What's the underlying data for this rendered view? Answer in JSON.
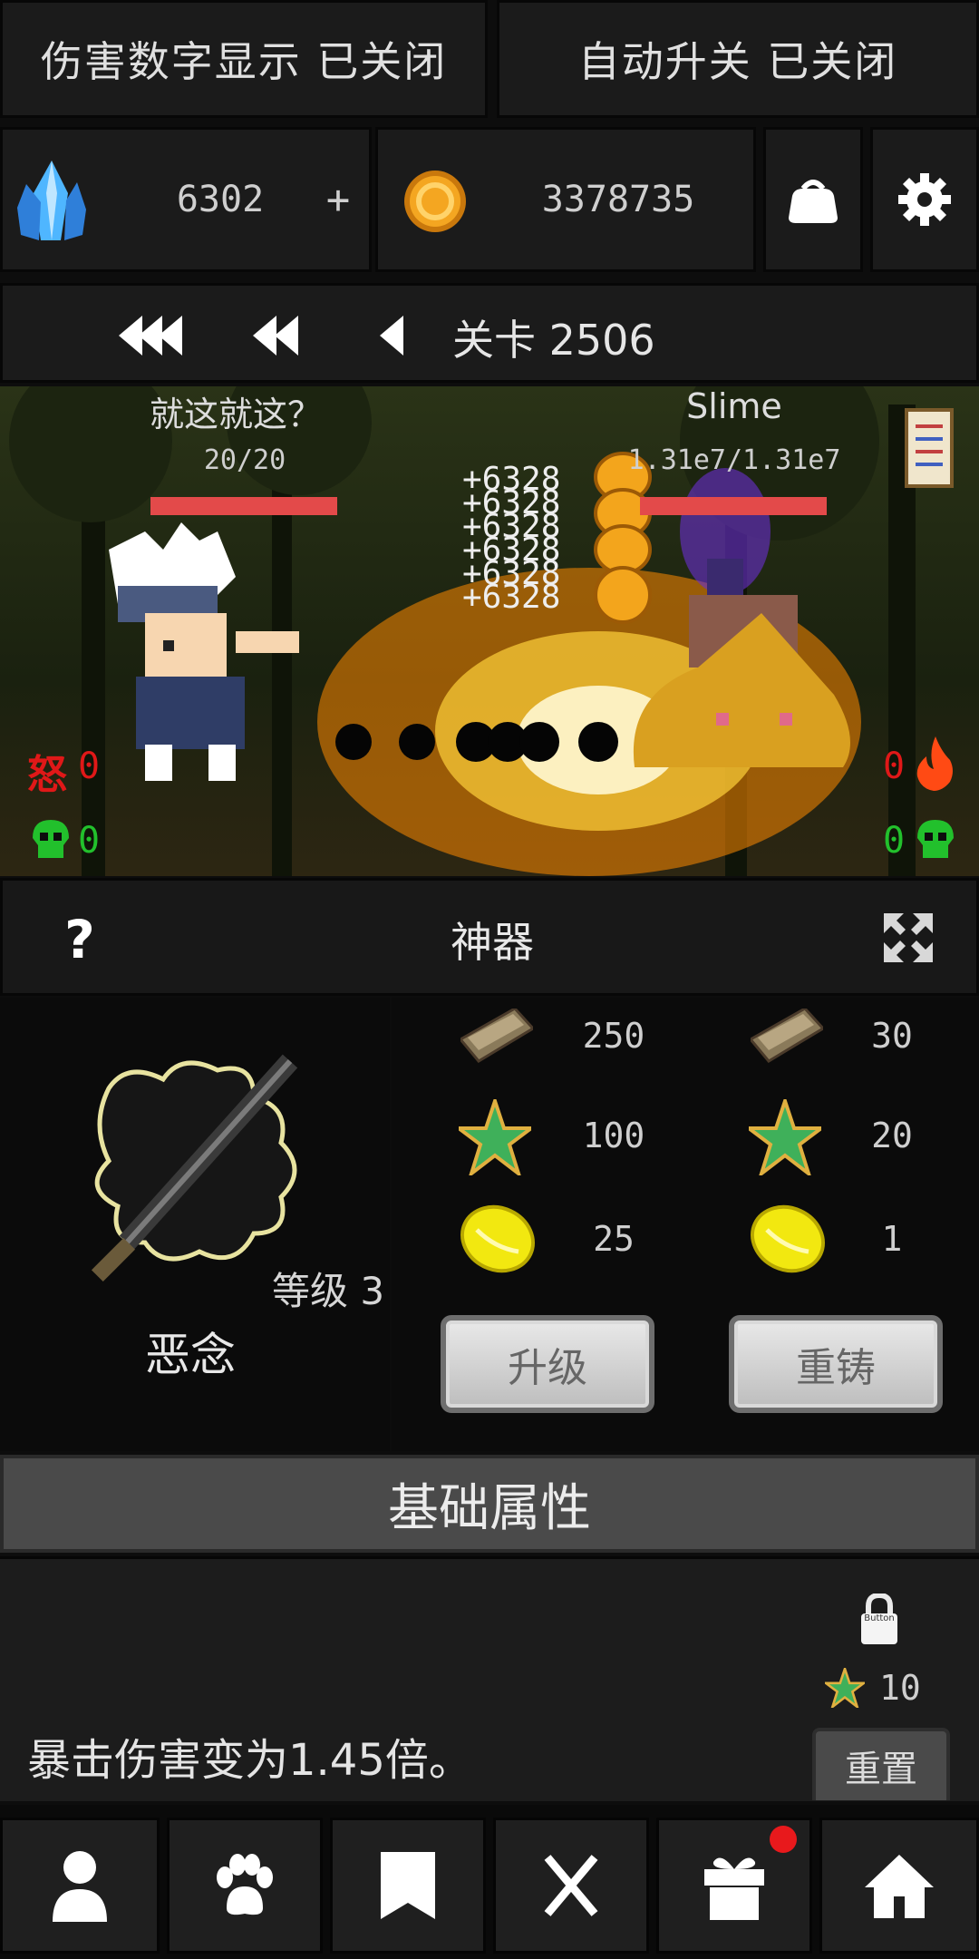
{
  "toggles": {
    "damage_numbers": "伤害数字显示 已关闭",
    "auto_upgrade": "自动升关 已关闭"
  },
  "currency": {
    "crystal_count": "6302",
    "plus_label": "+",
    "gold_count": "3378735"
  },
  "stage": {
    "label": "关卡 2506"
  },
  "battle": {
    "player_name": "就这就这？",
    "player_hp": "20/20",
    "player_hp_fraction": 1.0,
    "enemy_name": "Slime",
    "enemy_hp": "1.31e7/1.31e7",
    "enemy_hp_fraction": 1.0,
    "damage_popups": [
      "+6328",
      "+6328",
      "+6328",
      "+6328",
      "+6328",
      "+6328"
    ],
    "rage_glyph": "怒",
    "player_rage": "0",
    "player_kills": "0",
    "enemy_rage": "0",
    "enemy_kills": "0"
  },
  "artifact_panel": {
    "help_label": "?",
    "title": "神器",
    "item_name": "恶念",
    "level_text": "等级 3",
    "costs_left": [
      "250",
      "100",
      "25"
    ],
    "costs_right": [
      "30",
      "20",
      "1"
    ],
    "upgrade_label": "升级",
    "reforge_label": "重铸"
  },
  "attributes": {
    "header": "基础属性",
    "lock_caption": "Button",
    "star_cost": "10",
    "description": "暴击伤害变为1.45倍。",
    "reset_label": "重置"
  },
  "colors": {
    "accent_red": "#e34a4a",
    "kill_green": "#22c02c",
    "rage_red": "#e01818",
    "notification": "#e8191c"
  },
  "nav_icons": [
    "person-icon",
    "paw-icon",
    "bookmark-icon",
    "swords-icon",
    "gift-icon",
    "home-icon"
  ]
}
